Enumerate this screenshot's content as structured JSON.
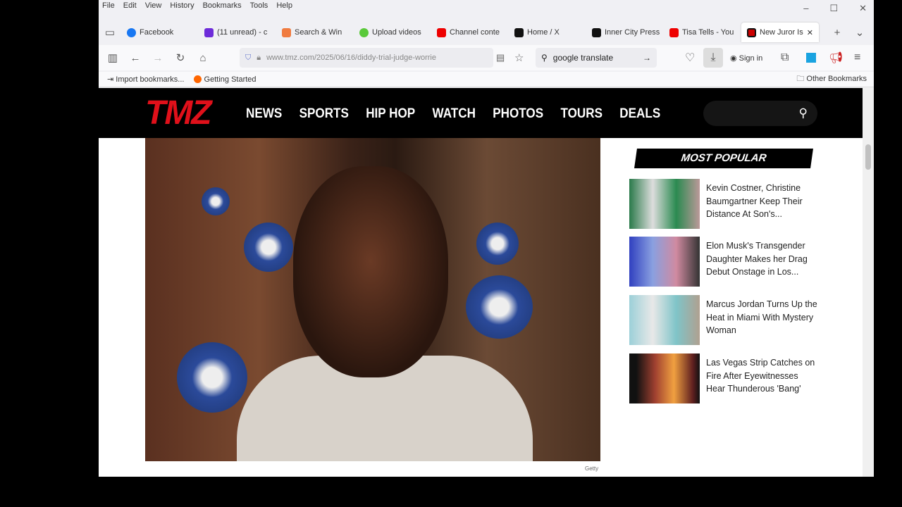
{
  "menu": [
    "File",
    "Edit",
    "View",
    "History",
    "Bookmarks",
    "Tools",
    "Help"
  ],
  "tabs": [
    {
      "label": "Facebook",
      "color": "#1877f2"
    },
    {
      "label": "(11 unread) - c",
      "color": "#6d2bd9"
    },
    {
      "label": "Search & Win",
      "color": "#f07b3f"
    },
    {
      "label": "Upload videos",
      "color": "#5ac93a"
    },
    {
      "label": "Channel conte",
      "color": "#e00"
    },
    {
      "label": "Home / X",
      "color": "#111"
    },
    {
      "label": "Inner City Press",
      "color": "#111"
    },
    {
      "label": "Tisa Tells - You",
      "color": "#e00"
    },
    {
      "label": "New Juror Is",
      "color": "#c00",
      "active": true
    }
  ],
  "url": "www.tmz.com/2025/06/16/diddy-trial-judge-worrie",
  "search": "google translate",
  "sign_in": "Sign in",
  "bookmarks": {
    "import": "Import bookmarks...",
    "getting_started": "Getting Started",
    "other": "Other Bookmarks"
  },
  "site": {
    "logo": "TMZ",
    "nav": [
      "NEWS",
      "SPORTS",
      "HIP HOP",
      "WATCH",
      "PHOTOS",
      "TOURS",
      "DEALS"
    ],
    "credit": "Getty",
    "most_popular": "MOST POPULAR",
    "items": [
      {
        "title": "Kevin Costner, Christine Baumgartner Keep Their Distance At Son's..."
      },
      {
        "title": "Elon Musk's Transgender Daughter Makes her Drag Debut Onstage in Los..."
      },
      {
        "title": "Marcus Jordan Turns Up the Heat in Miami With Mystery Woman"
      },
      {
        "title": "Las Vegas Strip Catches on Fire After Eyewitnesses Hear Thunderous 'Bang'"
      }
    ]
  }
}
